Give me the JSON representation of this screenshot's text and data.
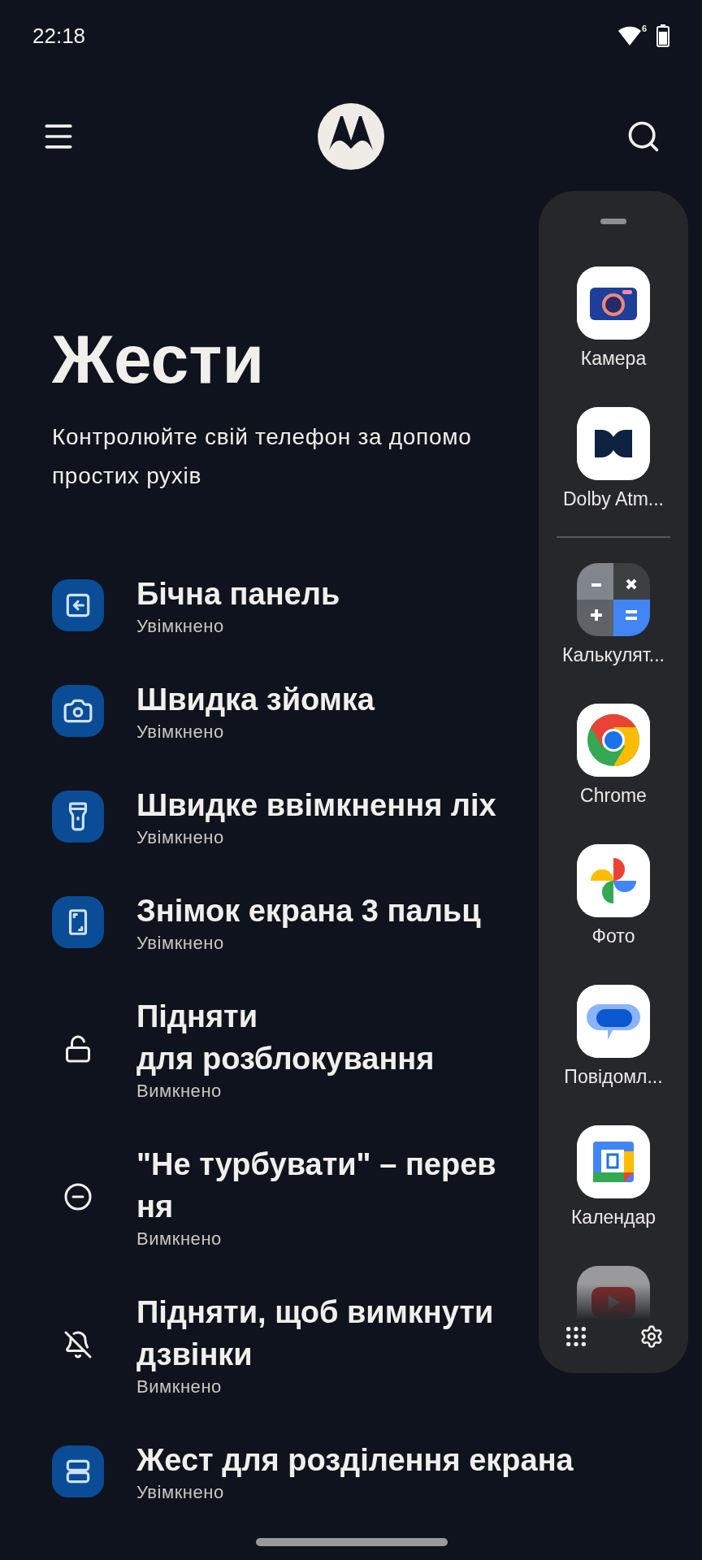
{
  "status_bar": {
    "time": "22:18",
    "wifi_badge": "6"
  },
  "header": {
    "title": "Жести",
    "subtitle_lines": [
      "Контролюйте свій телефон за допомо",
      "простих рухів"
    ]
  },
  "gestures": [
    {
      "kind": "tile",
      "title_lines": [
        "Бічна панель"
      ],
      "status": "Увімкнено"
    },
    {
      "kind": "tile",
      "title_lines": [
        "Швидка зйомка"
      ],
      "status": "Увімкнено"
    },
    {
      "kind": "tile",
      "title_lines": [
        "Швидке ввімкнення ліх"
      ],
      "status": "Увімкнено"
    },
    {
      "kind": "tile",
      "title_lines": [
        "Знімок екрана 3 пальц"
      ],
      "status": "Увімкнено"
    },
    {
      "kind": "plain",
      "title_lines": [
        "Підняти",
        "для розблокування"
      ],
      "status": "Вимкнено"
    },
    {
      "kind": "plain",
      "title_lines": [
        "\"Не турбувати\" – перев",
        "ня"
      ],
      "status": "Вимкнено"
    },
    {
      "kind": "plain",
      "title_lines": [
        "Підняти, щоб вимкнути",
        "дзвінки"
      ],
      "status": "Вимкнено"
    },
    {
      "kind": "tile",
      "title_lines": [
        "Жест для розділення екрана"
      ],
      "status": "Увімкнено"
    }
  ],
  "side_panel": {
    "apps": [
      {
        "kind": "app",
        "name": "Камера"
      },
      {
        "kind": "app",
        "name": "Dolby Atm..."
      },
      {
        "kind": "divider"
      },
      {
        "kind": "app",
        "name": "Калькулят..."
      },
      {
        "kind": "app",
        "name": "Chrome"
      },
      {
        "kind": "app",
        "name": "Фото"
      },
      {
        "kind": "app",
        "name": "Повідомл..."
      },
      {
        "kind": "app",
        "name": "Календар"
      },
      {
        "kind": "faded-app"
      }
    ]
  }
}
